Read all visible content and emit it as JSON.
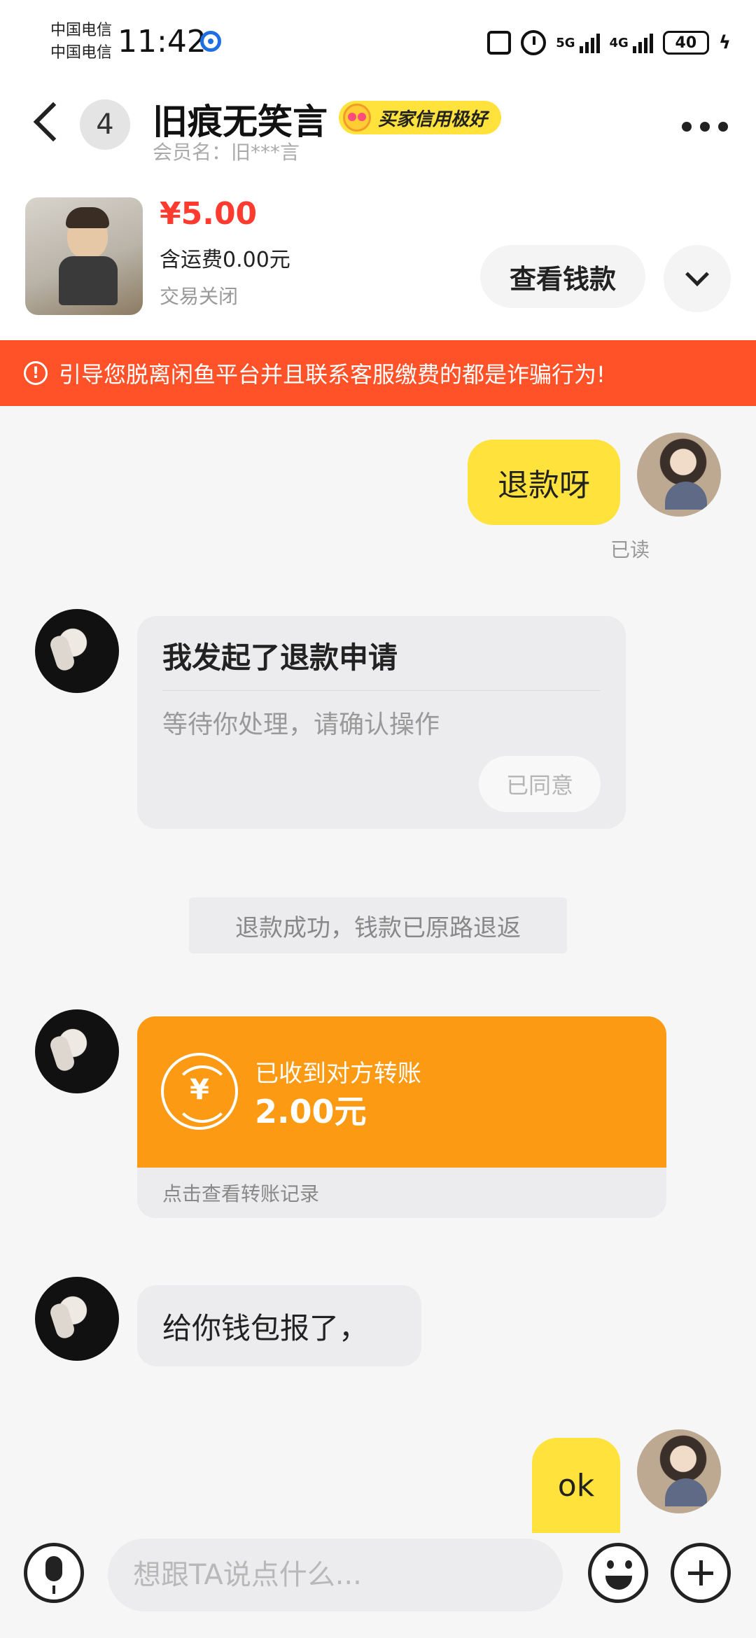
{
  "status_bar": {
    "carrier_1": "中国电信",
    "carrier_2": "中国电信",
    "time": "11:42",
    "network_1": "5G",
    "network_2": "4G",
    "battery": "40"
  },
  "header": {
    "unread_count": "4",
    "contact_name": "旧痕无笑言",
    "credit_badge": "买家信用极好",
    "member_label": "会员名：旧***言"
  },
  "product": {
    "price": "¥5.00",
    "shipping": "含运费0.00元",
    "status": "交易关闭",
    "view_money_label": "查看钱款"
  },
  "warning": {
    "icon": "!",
    "text": "引导您脱离闲鱼平台并且联系客服缴费的都是诈骗行为!"
  },
  "messages": {
    "m1": {
      "text": "退款呀",
      "read_status": "已读"
    },
    "refund_card": {
      "title": "我发起了退款申请",
      "subtitle": "等待你处理，请确认操作",
      "action_label": "已同意"
    },
    "system": "退款成功，钱款已原路退返",
    "transfer": {
      "icon": "¥",
      "label": "已收到对方转账",
      "amount": "2.00元",
      "link": "点击查看转账记录"
    },
    "m2": {
      "text": "给你钱包报了，"
    },
    "m3": {
      "text": "ok"
    }
  },
  "input": {
    "placeholder": "想跟TA说点什么..."
  },
  "colors": {
    "accent_yellow": "#ffe23b",
    "warning_orange": "#ff5228",
    "transfer_orange": "#fd9a14",
    "price_red": "#ff3b30"
  },
  "icons": {
    "back": "back-icon",
    "more": "more-icon",
    "expand": "chevron-down-icon",
    "voice": "mic-icon",
    "emoji": "emoji-icon",
    "plus": "plus-icon",
    "transfer": "yuan-icon"
  }
}
